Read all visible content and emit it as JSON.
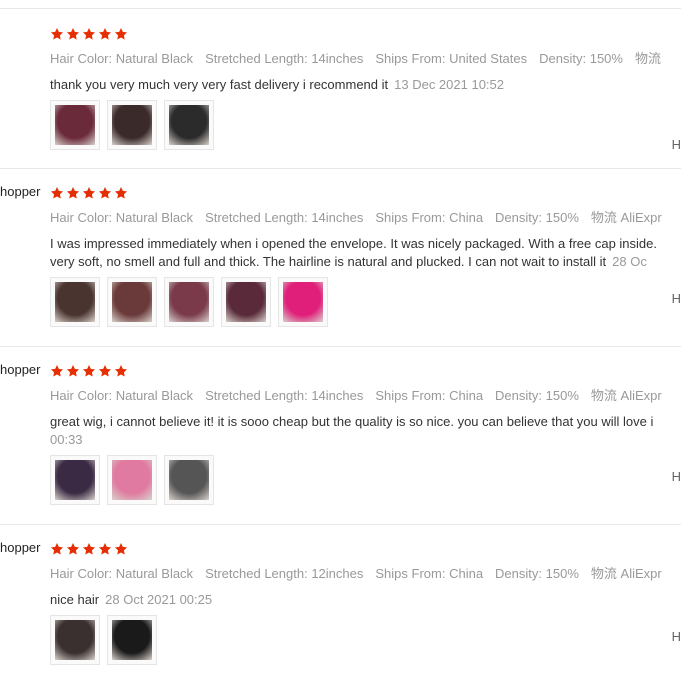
{
  "colors": {
    "star": "#e62e04",
    "muted": "#999999",
    "text": "#333333"
  },
  "reviews": [
    {
      "buyer": "",
      "rating": 5,
      "attributes": [
        {
          "label": "Hair Color:",
          "value": "Natural Black"
        },
        {
          "label": "Stretched Length:",
          "value": "14inches"
        },
        {
          "label": "Ships From:",
          "value": "United States"
        },
        {
          "label": "Density:",
          "value": "150%"
        },
        {
          "label": "物流",
          "value": ""
        }
      ],
      "text_lines": [
        "thank you very much very very fast delivery i recommend it"
      ],
      "date": "13 Dec 2021 10:52",
      "photos": [
        "review-photo",
        "review-photo",
        "review-photo"
      ],
      "helpful": "H"
    },
    {
      "buyer": "hopper",
      "rating": 5,
      "attributes": [
        {
          "label": "Hair Color:",
          "value": "Natural Black"
        },
        {
          "label": "Stretched Length:",
          "value": "14inches"
        },
        {
          "label": "Ships From:",
          "value": "China"
        },
        {
          "label": "Density:",
          "value": "150%"
        },
        {
          "label": "物流",
          "value": "AliExpr"
        }
      ],
      "text_lines": [
        "I was impressed immediately when i opened the envelope. It was nicely packaged. With a free cap inside.",
        "very soft, no smell and full and thick. The hairline is natural and plucked. I can not wait to install it"
      ],
      "date": "28 Oc",
      "photos": [
        "review-photo",
        "review-photo",
        "review-photo",
        "review-photo",
        "review-photo"
      ],
      "helpful": "H"
    },
    {
      "buyer": "hopper",
      "rating": 5,
      "attributes": [
        {
          "label": "Hair Color:",
          "value": "Natural Black"
        },
        {
          "label": "Stretched Length:",
          "value": "14inches"
        },
        {
          "label": "Ships From:",
          "value": "China"
        },
        {
          "label": "Density:",
          "value": "150%"
        },
        {
          "label": "物流",
          "value": "AliExpr"
        }
      ],
      "text_lines": [
        "great wig, i cannot believe it! it is sooo cheap but the quality is so nice. you can believe that you will love i",
        ""
      ],
      "date": "00:33",
      "photos": [
        "review-photo",
        "review-photo",
        "review-photo"
      ],
      "helpful": "H"
    },
    {
      "buyer": "hopper",
      "rating": 5,
      "attributes": [
        {
          "label": "Hair Color:",
          "value": "Natural Black"
        },
        {
          "label": "Stretched Length:",
          "value": "12inches"
        },
        {
          "label": "Ships From:",
          "value": "China"
        },
        {
          "label": "Density:",
          "value": "150%"
        },
        {
          "label": "物流",
          "value": "AliExpr"
        }
      ],
      "text_lines": [
        "nice hair"
      ],
      "date": "28 Oct 2021 00:25",
      "photos": [
        "review-photo",
        "review-photo"
      ],
      "helpful": "H"
    }
  ]
}
